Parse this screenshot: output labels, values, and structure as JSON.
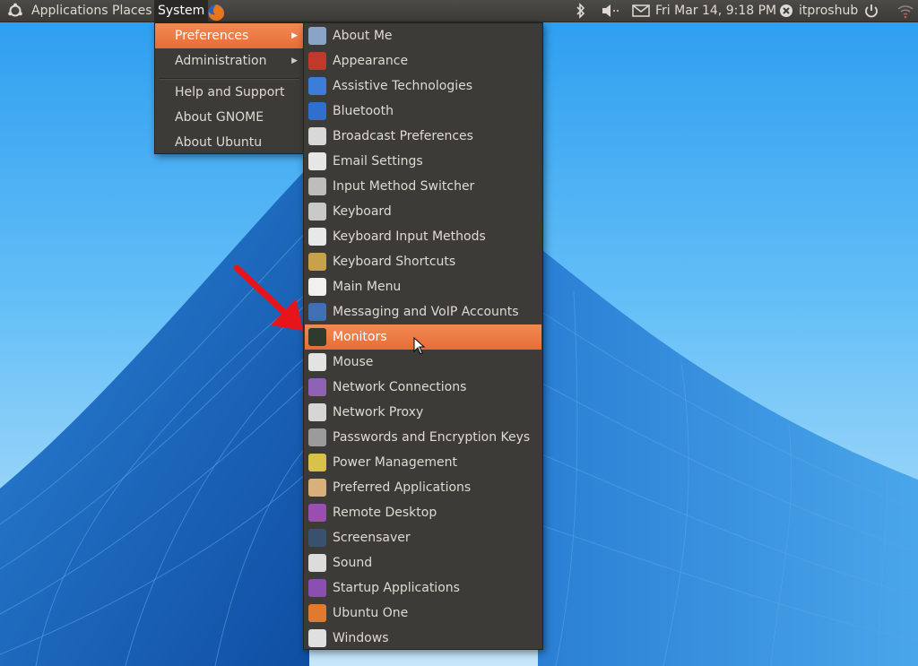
{
  "panel": {
    "menus": [
      "Applications",
      "Places",
      "System"
    ],
    "clock": "Fri Mar 14,  9:18 PM",
    "user": "itproshub"
  },
  "system_menu": {
    "items": [
      {
        "label": "Preferences",
        "submenu": true,
        "highlighted": true
      },
      {
        "label": "Administration",
        "submenu": true
      },
      {
        "label": "Help and Support"
      },
      {
        "label": "About GNOME"
      },
      {
        "label": "About Ubuntu"
      }
    ]
  },
  "preferences_menu": {
    "items": [
      {
        "label": "About Me",
        "icon": "about-me-icon",
        "color": "#8aa4c8"
      },
      {
        "label": "Appearance",
        "icon": "appearance-icon",
        "color": "#c0392b"
      },
      {
        "label": "Assistive Technologies",
        "icon": "accessibility-icon",
        "color": "#3b7dd8"
      },
      {
        "label": "Bluetooth",
        "icon": "bluetooth-icon",
        "color": "#2f6fd0"
      },
      {
        "label": "Broadcast Preferences",
        "icon": "broadcast-icon",
        "color": "#d8d8d8"
      },
      {
        "label": "Email Settings",
        "icon": "email-icon",
        "color": "#e6e6e6"
      },
      {
        "label": "Input Method Switcher",
        "icon": "keyboard-icon",
        "color": "#bdbdbd"
      },
      {
        "label": "Keyboard",
        "icon": "keyboard-icon",
        "color": "#c9c9c9"
      },
      {
        "label": "Keyboard Input Methods",
        "icon": "info-icon",
        "color": "#e8e8e8"
      },
      {
        "label": "Keyboard Shortcuts",
        "icon": "shortcuts-icon",
        "color": "#c8a24a"
      },
      {
        "label": "Main Menu",
        "icon": "main-menu-icon",
        "color": "#f0f0f0"
      },
      {
        "label": "Messaging and VoIP Accounts",
        "icon": "messaging-icon",
        "color": "#3f6fb5"
      },
      {
        "label": "Monitors",
        "icon": "monitor-icon",
        "color": "#2d3a2c",
        "highlighted": true
      },
      {
        "label": "Mouse",
        "icon": "mouse-icon",
        "color": "#e3e3e3"
      },
      {
        "label": "Network Connections",
        "icon": "network-icon",
        "color": "#8e63b5"
      },
      {
        "label": "Network Proxy",
        "icon": "proxy-icon",
        "color": "#d6d6d6"
      },
      {
        "label": "Passwords and Encryption Keys",
        "icon": "keys-icon",
        "color": "#9b9b9b"
      },
      {
        "label": "Power Management",
        "icon": "power-management-icon",
        "color": "#d9c24a"
      },
      {
        "label": "Preferred Applications",
        "icon": "preferred-apps-icon",
        "color": "#d8b07a"
      },
      {
        "label": "Remote Desktop",
        "icon": "remote-desktop-icon",
        "color": "#9a4fb0"
      },
      {
        "label": "Screensaver",
        "icon": "screensaver-icon",
        "color": "#39516e"
      },
      {
        "label": "Sound",
        "icon": "sound-icon",
        "color": "#dcdcdc"
      },
      {
        "label": "Startup Applications",
        "icon": "startup-icon",
        "color": "#8a4fb0"
      },
      {
        "label": "Ubuntu One",
        "icon": "ubuntu-one-icon",
        "color": "#e07a2e"
      },
      {
        "label": "Windows",
        "icon": "windows-icon",
        "color": "#e0e0e0"
      }
    ]
  },
  "colors": {
    "panel_bg": "#3c3b37",
    "menu_bg": "#3c3b37",
    "highlight": "#e86d35",
    "annotation_arrow": "#e8141b"
  }
}
